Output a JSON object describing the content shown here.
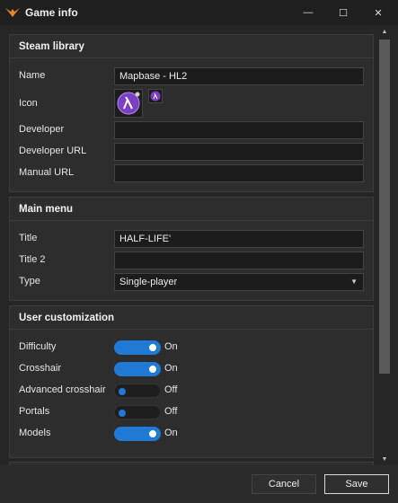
{
  "window": {
    "title": "Game info",
    "icon": "bird-logo-icon",
    "minimize_glyph": "—",
    "maximize_glyph": "☐",
    "close_glyph": "✕"
  },
  "sections": {
    "steam_library": {
      "header": "Steam library",
      "name_label": "Name",
      "name_value": "Mapbase - HL2",
      "icon_label": "Icon",
      "developer_label": "Developer",
      "developer_value": "",
      "developer_url_label": "Developer URL",
      "developer_url_value": "",
      "manual_url_label": "Manual URL",
      "manual_url_value": ""
    },
    "main_menu": {
      "header": "Main menu",
      "title_label": "Title",
      "title_value": "HALF-LIFE'",
      "title2_label": "Title 2",
      "title2_value": "",
      "type_label": "Type",
      "type_value": "Single-player"
    },
    "user_customization": {
      "header": "User customization",
      "items": [
        {
          "label": "Difficulty",
          "state": "On",
          "on": true
        },
        {
          "label": "Crosshair",
          "state": "On",
          "on": true
        },
        {
          "label": "Advanced crosshair",
          "state": "Off",
          "on": false
        },
        {
          "label": "Portals",
          "state": "Off",
          "on": false
        },
        {
          "label": "Models",
          "state": "On",
          "on": true
        }
      ]
    }
  },
  "footer": {
    "cancel_label": "Cancel",
    "save_label": "Save"
  },
  "colors": {
    "accent": "#1f7ad6",
    "icon_purple": "#7b3fc4",
    "logo_orange": "#e8862a"
  }
}
